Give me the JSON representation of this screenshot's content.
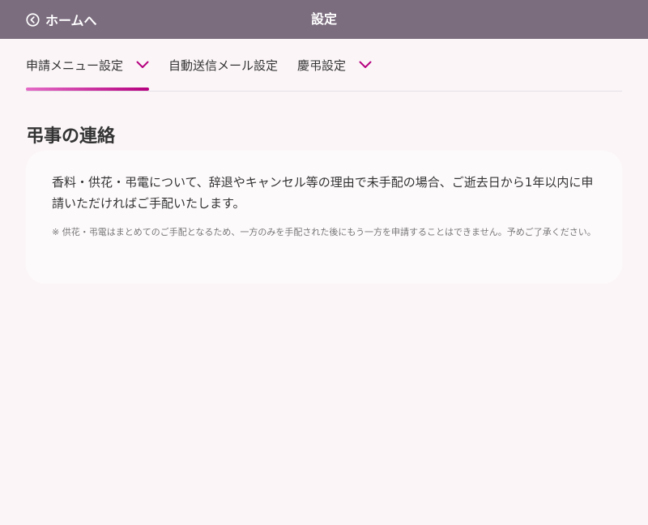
{
  "header": {
    "back_label": "ホームへ",
    "title": "設定"
  },
  "tabs": [
    {
      "label": "申請メニュー設定",
      "has_dropdown": true,
      "active": true
    },
    {
      "label": "自動送信メール設定",
      "has_dropdown": false,
      "active": false
    },
    {
      "label": "慶弔設定",
      "has_dropdown": true,
      "active": false
    }
  ],
  "section": {
    "title": "弔事の連絡",
    "text": "香料・供花・弔電について、辞退やキャンセル等の理由で未手配の場合、ご逝去日から1年以内に申請いただければご手配いたします。",
    "note": "※ 供花・弔電はまとめてのご手配となるため、一方のみを手配された後にもう一方を申請することはできません。予めご了承ください。"
  },
  "colors": {
    "header_bg": "#7b6c7e",
    "accent": "#b5007f",
    "background": "#fbf5f7"
  }
}
